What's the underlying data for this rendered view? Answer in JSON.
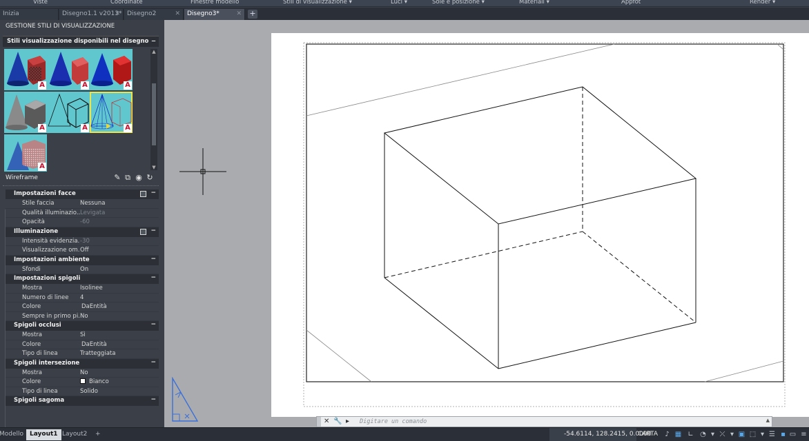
{
  "ribbon": {
    "panels": [
      "Viste",
      "Coordinate",
      "Finestre modello",
      "Stili di visualizzazione",
      "Luci",
      "Sole e posizione",
      "Materiali",
      "Appfot",
      "Render"
    ]
  },
  "file_tabs": {
    "tabs": [
      {
        "label": "Inizia",
        "active": false
      },
      {
        "label": "Disegno1.1 v2013*",
        "active": false
      },
      {
        "label": "Disegno2",
        "active": false
      },
      {
        "label": "Disegno3*",
        "active": true
      }
    ],
    "add_label": "+"
  },
  "palette": {
    "title": "GESTIONE STILI DI VISUALIZZAZIONE",
    "styles_header": "Stili visualizzazione disponibili nel disegno",
    "collapse_glyph": "−",
    "badge_letter": "A",
    "selected_style_name": "Wireframe",
    "sections": [
      {
        "title": "Impostazioni facce",
        "rows": [
          {
            "label": "Stile faccia",
            "value": "Nessuna",
            "dim": false
          },
          {
            "label": "Qualità illuminazio...",
            "value": "Levigata",
            "dim": true
          },
          {
            "label": "Opacità",
            "value": "-60",
            "dim": true
          }
        ]
      },
      {
        "title": "Illuminazione",
        "rows": [
          {
            "label": "Intensità evidenzia...",
            "value": "-30",
            "dim": true
          },
          {
            "label": "Visualizzazione om...",
            "value": "Off",
            "dim": false
          }
        ]
      },
      {
        "title": "Impostazioni ambiente",
        "rows": [
          {
            "label": "Sfondi",
            "value": "On",
            "dim": false
          }
        ]
      },
      {
        "title": "Impostazioni spigoli",
        "rows": [
          {
            "label": "Mostra",
            "value": "Isolinee",
            "dim": false
          },
          {
            "label": "Numero di linee",
            "value": "4",
            "dim": false
          },
          {
            "label": "Colore",
            "value": "DaEntità",
            "dim": false
          },
          {
            "label": "Sempre in primo pi...",
            "value": "No",
            "dim": false
          }
        ]
      },
      {
        "title": "Spigoli occlusi",
        "rows": [
          {
            "label": "Mostra",
            "value": "Sì",
            "dim": false
          },
          {
            "label": "Colore",
            "value": "DaEntità",
            "dim": false
          },
          {
            "label": "Tipo di linea",
            "value": "Tratteggiata",
            "dim": false
          }
        ]
      },
      {
        "title": "Spigoli intersezione",
        "rows": [
          {
            "label": "Mostra",
            "value": "No",
            "dim": false
          },
          {
            "label": "Colore",
            "value": "Bianco",
            "dim": false,
            "swatch": "#ffffff"
          },
          {
            "label": "Tipo di linea",
            "value": "Solido",
            "dim": false
          }
        ]
      },
      {
        "title": "Spigoli sagoma",
        "rows": []
      }
    ]
  },
  "command_line": {
    "placeholder": "Digitare un comando"
  },
  "status_bar": {
    "layout_tabs": [
      {
        "label": "Modello",
        "active": false
      },
      {
        "label": "Layout1",
        "active": true
      },
      {
        "label": "Layout2",
        "active": false
      }
    ],
    "add_label": "+",
    "coordinates": "-54.6114, 128.2415, 0.0000",
    "space": "CARTA"
  },
  "colors": {
    "thumbnail_bg": "#60c7cf",
    "selection_outline": "#ebe44a",
    "status_icon_active": "#5aa7e8",
    "ucs_icon": "#3a6fd8"
  }
}
